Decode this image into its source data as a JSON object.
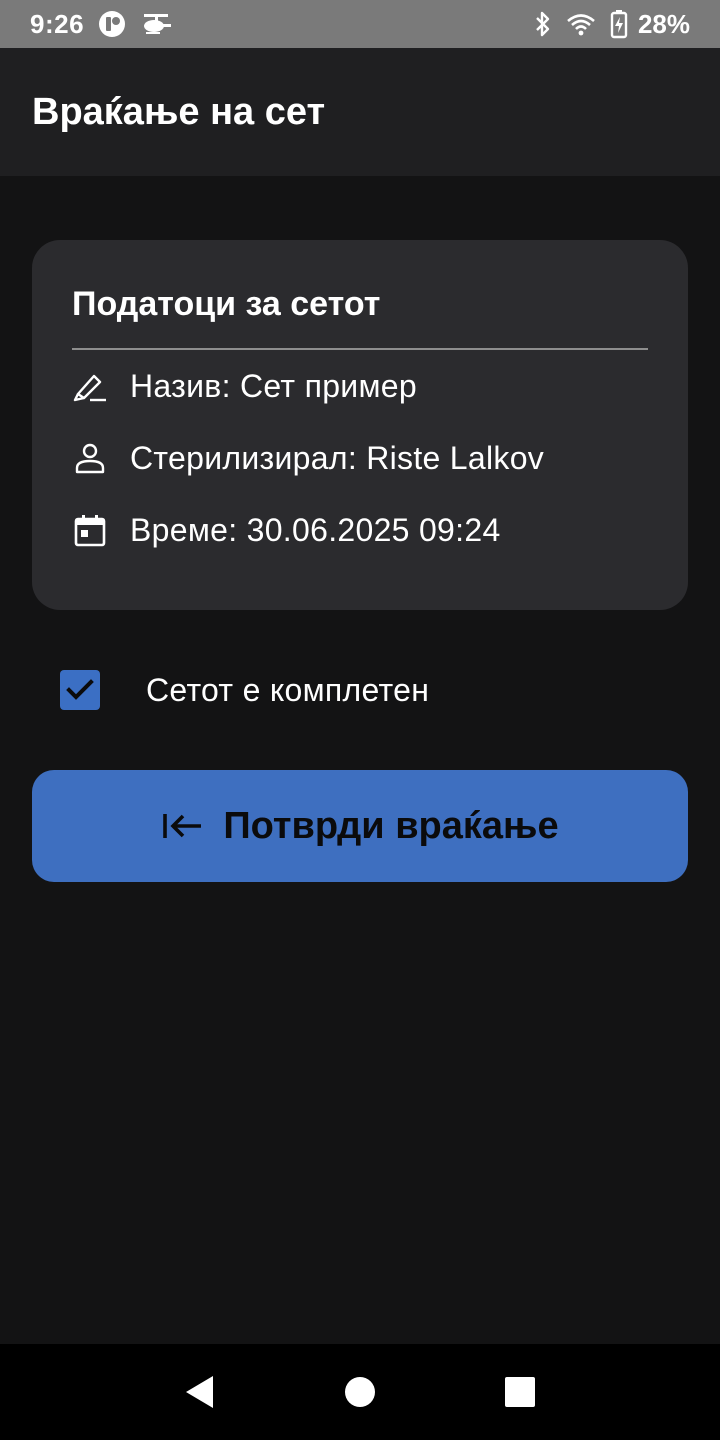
{
  "status_bar": {
    "time": "9:26",
    "battery": "28%",
    "icons": [
      "notification-app-icon",
      "helicopter-icon",
      "bluetooth-icon",
      "wifi-icon",
      "battery-charging-icon"
    ]
  },
  "app_bar": {
    "title": "Враќање на сет"
  },
  "card": {
    "title": "Податоци за сетот",
    "rows": [
      {
        "icon": "edit-pen-icon",
        "text": "Назив: Сет пример"
      },
      {
        "icon": "person-icon",
        "text": "Стерилизирал: Riste Lalkov"
      },
      {
        "icon": "calendar-icon",
        "text": "Време: 30.06.2025 09:24"
      }
    ]
  },
  "checkbox": {
    "label": "Сетот е комплетен",
    "checked": true
  },
  "confirm_button": {
    "label": "Потврди враќање",
    "icon": "arrow-left-to-line-icon"
  },
  "nav_bar": {
    "buttons": [
      "back-triangle-icon",
      "home-circle-icon",
      "recents-square-icon"
    ]
  },
  "colors": {
    "background": "#131314",
    "app_bar": "#1f1f21",
    "card": "#2b2b2e",
    "accent": "#3e6fc0"
  }
}
